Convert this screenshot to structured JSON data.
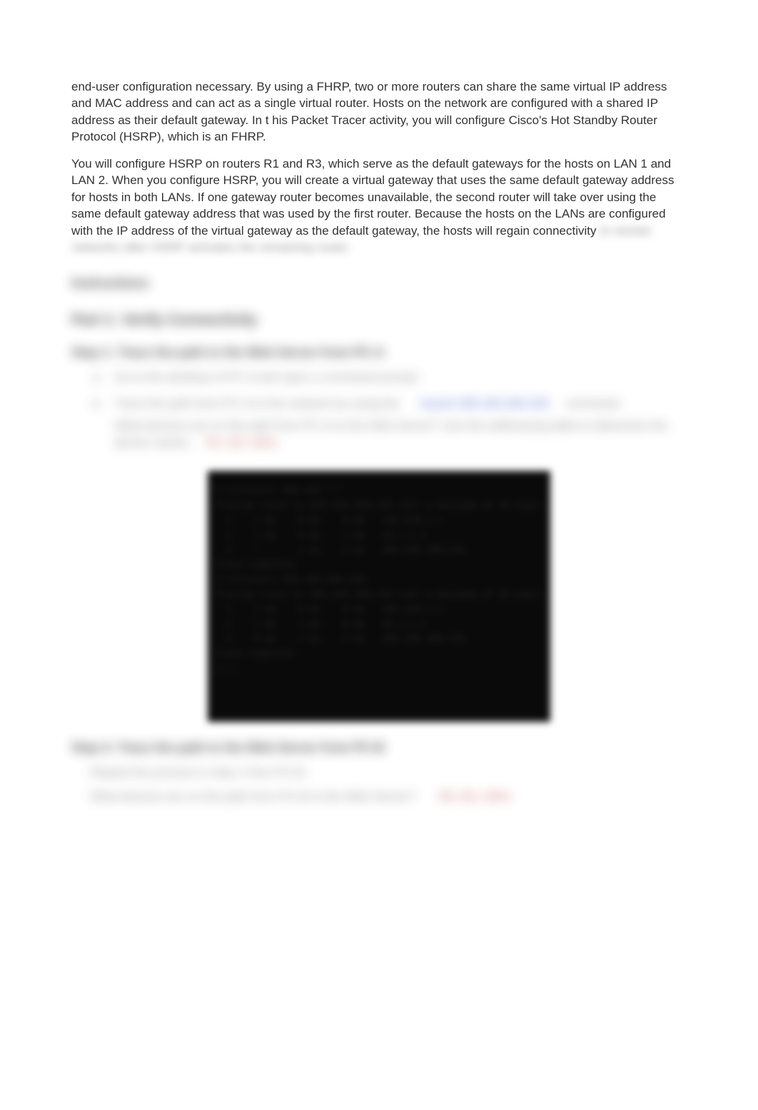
{
  "paragraphs": {
    "p1": "end-user configuration necessary. By using a FHRP, two or more routers can share the same virtual IP address and MAC address and can act as a single virtual router. Hosts on the network are configured with a shared IP address as their default gateway. In t his Packet Tracer activity, you will configure Cisco's Hot Standby Router Protocol (HSRP), which is an FHRP.",
    "p2": "You will configure HSRP on routers R1 and R3, which serve as the default gateways for the hosts on LAN 1 and LAN 2. When you configure HSRP, you will create a virtual gateway that uses the same default gateway address for hosts in both LANs. If one gateway router becomes unavailable, the second router will take over using the same default gateway address that was used by the first router. Because the hosts on the LANs are configured with the IP address of the virtual gateway as the default gateway, the hosts will regain connectivity",
    "p3_blurred": "to remote networks after HSRP activates the remaining router."
  },
  "instructions_heading": "Instructions",
  "part1_heading": "Part 1: Verify Connectivity",
  "step1": {
    "heading": "Step 1: Trace the path to the Web Server from PC-A",
    "a": "Go to the desktop of PC-A and open a command prompt.",
    "b_pre": "Trace the path from PC-A to the network by using the",
    "b_cmd": "tracert 209.165.200.226",
    "b_post": "command.",
    "q_line1": "What devices are on the path from PC-A to the Web Server? Use the addressing table to determine the",
    "q_line2_prefix": "device names.",
    "q_line2_answer": "R1, R2, ISPa"
  },
  "terminal": {
    "l1": "C:\\>tracert 209.165.***",
    "l2": "Tracing route to 209.165.200.226 over a maximum of 30 hops:",
    "l3": "  1    1 ms    0 ms    0 ms   192.168.1.1",
    "l4": "  2    1 ms    0 ms    1 ms   10.1.1.2",
    "l5": "  3    *       1 ms    2 ms   209.165.200.226",
    "l6": "Trace complete.",
    "l7": "C:\\>tracert 209.165.200.226",
    "l8": "Tracing route to 209.165.200.226 over a maximum of 30 hops:",
    "l9": "  1    1 ms    0 ms    0 ms   192.168.1.1",
    "l10": "  2    1 ms    1 ms    0 ms   10.1.1.2",
    "l11": "  3    0 ms    1 ms    2 ms   209.165.200.226",
    "l12": "Trace complete.",
    "l13": "C:\\>"
  },
  "step3": {
    "heading": "Step 3: Trace the path to the Web Server from PC-B",
    "body1": "Repeat the process in step 1 from PC-B.",
    "body2_q": "What devices are on the path from PC-B to the Web Server?",
    "body2_a": "R3, R2, ISPa"
  }
}
